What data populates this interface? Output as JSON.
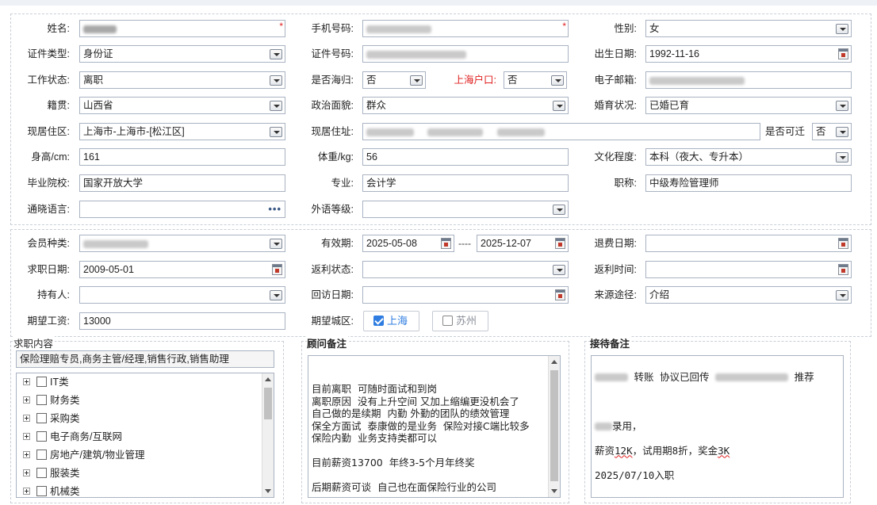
{
  "form": {
    "name": {
      "label": "姓名:"
    },
    "mobile": {
      "label": "手机号码:"
    },
    "gender": {
      "label": "性别:",
      "value": "女"
    },
    "id_type": {
      "label": "证件类型:",
      "value": "身份证"
    },
    "id_number": {
      "label": "证件号码:"
    },
    "birth_date": {
      "label": "出生日期:",
      "value": "1992-11-16"
    },
    "work_status": {
      "label": "工作状态:",
      "value": "离职"
    },
    "returnee": {
      "label": "是否海归:",
      "value": "否"
    },
    "shanghai_hukou": {
      "label": "上海户口:",
      "value": "否"
    },
    "email": {
      "label": "电子邮箱:"
    },
    "native_place": {
      "label": "籍贯:",
      "value": "山西省"
    },
    "political": {
      "label": "政治面貌:",
      "value": "群众"
    },
    "marital": {
      "label": "婚育状况:",
      "value": "已婚已育"
    },
    "current_area": {
      "label": "现居住区:",
      "value": "上海市-上海市-[松江区]"
    },
    "current_address": {
      "label": "现居住址:"
    },
    "relocatable": {
      "label": "是否可迁",
      "value": "否"
    },
    "height": {
      "label": "身高/cm:",
      "value": "161"
    },
    "weight": {
      "label": "体重/kg:",
      "value": "56"
    },
    "education": {
      "label": "文化程度:",
      "value": "本科（夜大、专升本）"
    },
    "school": {
      "label": "毕业院校:",
      "value": "国家开放大学"
    },
    "major": {
      "label": "专业:",
      "value": "会计学"
    },
    "title": {
      "label": "职称:",
      "value": "中级寿险管理师"
    },
    "languages": {
      "label": "通晓语言:",
      "value": ""
    },
    "foreign_level": {
      "label": "外语等级:",
      "value": ""
    }
  },
  "membership": {
    "member_type": {
      "label": "会员种类:"
    },
    "validity": {
      "label": "有效期:",
      "start": "2025-05-08",
      "sep": "----",
      "end": "2025-12-07"
    },
    "refund_date": {
      "label": "退费日期:",
      "value": ""
    },
    "job_date": {
      "label": "求职日期:",
      "value": "2009-05-01"
    },
    "rebate_status": {
      "label": "返利状态:",
      "value": ""
    },
    "rebate_time": {
      "label": "返利时间:",
      "value": ""
    },
    "holder": {
      "label": "持有人:",
      "value": ""
    },
    "revisit_date": {
      "label": "回访日期:",
      "value": ""
    },
    "source": {
      "label": "来源途径:",
      "value": "介绍"
    },
    "expected_salary": {
      "label": "期望工资:",
      "value": "13000"
    },
    "expected_city": {
      "label": "期望城区:",
      "options": [
        {
          "label": "上海",
          "checked": true
        },
        {
          "label": "苏州",
          "checked": false
        }
      ]
    }
  },
  "job_content": {
    "title": "求职内容",
    "selected": "保险理赔专员,商务主管/经理,销售行政,销售助理",
    "categories": [
      "IT类",
      "财务类",
      "采购类",
      "电子商务/互联网",
      "房地产/建筑/物业管理",
      "服装类",
      "机械类"
    ]
  },
  "consultant_notes": {
    "title": "顾问备注",
    "lines": [
      "目前离职  可随时面试和到岗",
      "离职原因  没有上升空间 又加上缩编更没机会了",
      "自己做的是续期  内勤 外勤的团队的绩效管理",
      "保全方面试  泰康做的是业务  保险对接C端比较多",
      "保险内勤  业务支持类都可以",
      "",
      "目前薪资13700  年终3-5个月年终奖",
      "",
      "后期薪资可谈  自己也在面保险行业的公司"
    ]
  },
  "reception_notes": {
    "title": "接待备注",
    "line1_a": "转账 协议已回传",
    "line1_b": "推荐",
    "line2": "录用，",
    "line3_pre": "薪资",
    "line3_ul": "12K",
    "line3_post": "，试用期8折，奖金",
    "line3_ul2": "3K",
    "line4": "2025/07/10入职"
  },
  "colors": {
    "required": "#e02020",
    "accent": "#2f7de1",
    "border": "#a9b3c2"
  }
}
